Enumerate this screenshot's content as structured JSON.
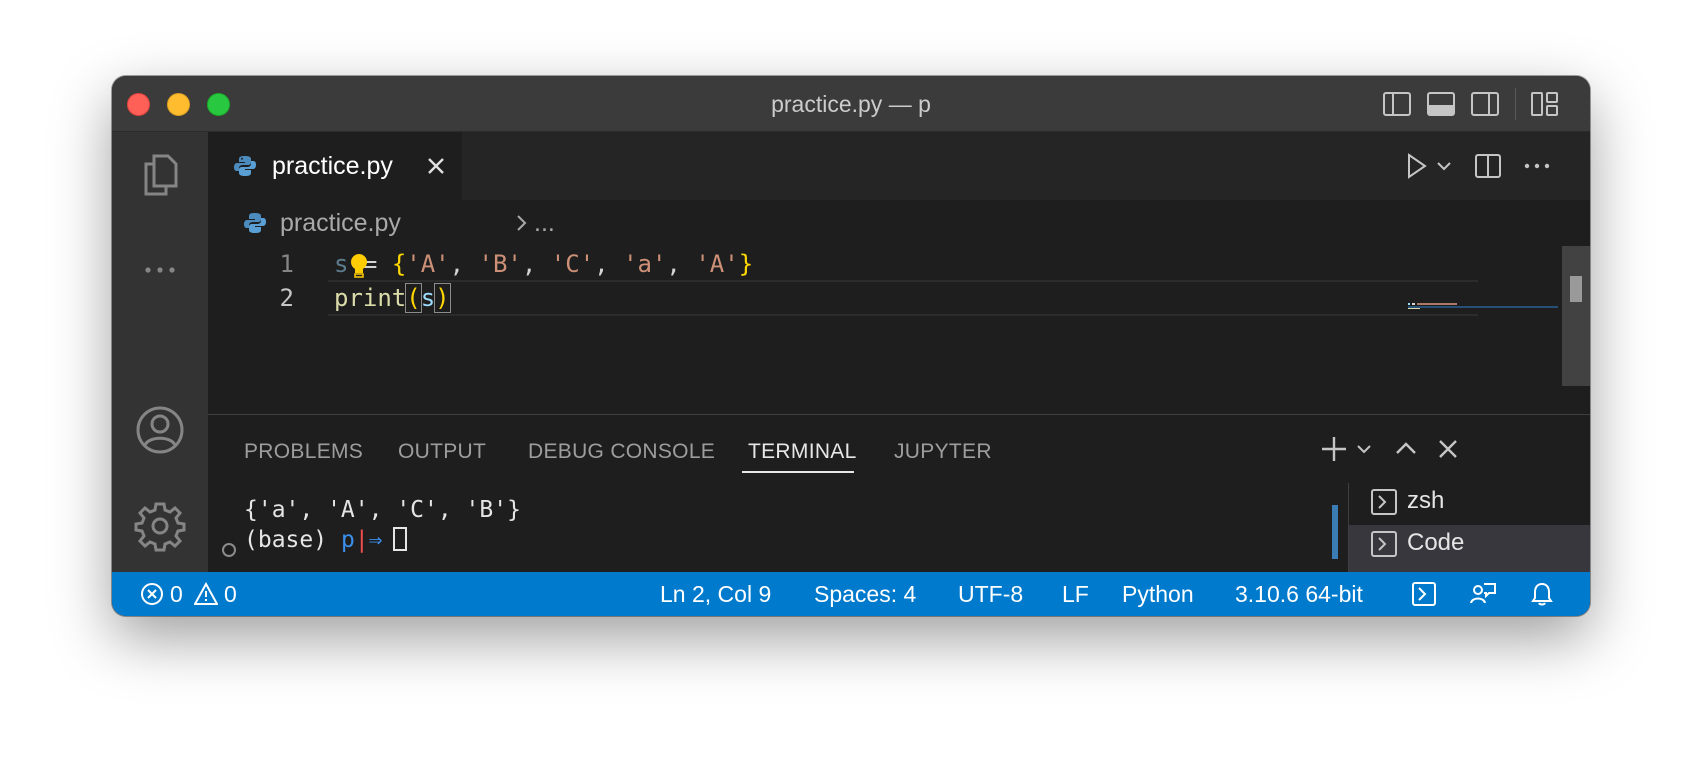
{
  "window": {
    "title": "practice.py — p"
  },
  "activity_bar": {
    "items": [
      {
        "name": "explorer",
        "icon": "files-icon"
      },
      {
        "name": "more",
        "icon": "ellipsis-icon"
      },
      {
        "name": "accounts",
        "icon": "account-icon"
      },
      {
        "name": "manage",
        "icon": "gear-icon"
      }
    ]
  },
  "editor": {
    "tab": {
      "label": "practice.py"
    },
    "breadcrumb": {
      "file": "practice.py",
      "more": "..."
    },
    "lines": [
      {
        "number": "1",
        "tokens": [
          "s",
          " = ",
          "{",
          "'A'",
          ", ",
          "'B'",
          ", ",
          "'C'",
          ", ",
          "'a'",
          ", ",
          "'A'",
          "}"
        ]
      },
      {
        "number": "2",
        "tokens": [
          "print",
          "(",
          "s",
          ")"
        ]
      }
    ]
  },
  "panel": {
    "tabs": [
      "PROBLEMS",
      "OUTPUT",
      "DEBUG CONSOLE",
      "TERMINAL",
      "JUPYTER"
    ],
    "active_tab": "TERMINAL",
    "terminal": {
      "output": "{'a', 'A', 'C', 'B'}",
      "prompt_base": "(base)",
      "prompt_dir": "p",
      "prompt_sep": "|",
      "prompt_arrow": "⇒"
    },
    "terminals": [
      {
        "label": "zsh",
        "selected": false
      },
      {
        "label": "Code",
        "selected": true
      }
    ]
  },
  "status_bar": {
    "errors": "0",
    "warnings": "0",
    "position": "Ln 2, Col 9",
    "spaces": "Spaces: 4",
    "encoding": "UTF-8",
    "eol": "LF",
    "language": "Python",
    "interpreter": "3.10.6 64-bit"
  },
  "colors": {
    "status_bar": "#007acc",
    "editor_bg": "#1e1e1e",
    "activity_bar": "#333333"
  }
}
